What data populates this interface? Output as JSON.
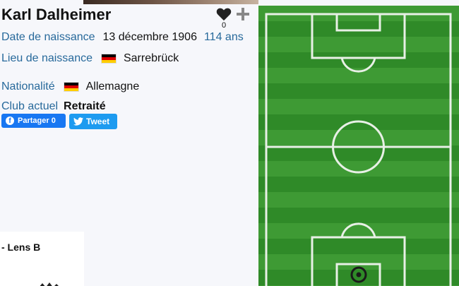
{
  "player": {
    "name": "Karl Dalheimer",
    "favorites_count": "0"
  },
  "details": {
    "birth_date_label": "Date de naissance",
    "birth_date": "13 décembre 1906",
    "age": "114 ans",
    "birth_place_label": "Lieu de naissance",
    "birth_place": "Sarrebrück",
    "nationality_label": "Nationalité",
    "nationality": "Allemagne",
    "club_label": "Club actuel",
    "club": "Retraité"
  },
  "share": {
    "facebook_label": "Partager 0",
    "twitter_label": "Tweet"
  },
  "career": {
    "team": "- Lens B"
  },
  "colors": {
    "accent": "#27699b",
    "facebook": "#1877f2",
    "twitter": "#1d9bf0",
    "pitch_light": "#3e9a34",
    "pitch_dark": "#2f8a28"
  },
  "icons": {
    "favorite": "heart-icon",
    "add": "plus-icon",
    "facebook": "facebook-icon",
    "twitter": "twitter-bird-icon",
    "position": "position-marker-icon",
    "flag": "flag-germany-icon"
  }
}
